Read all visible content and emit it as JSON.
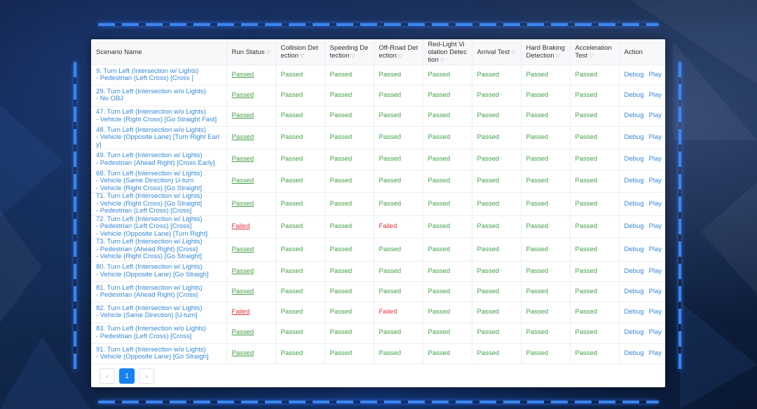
{
  "columns": [
    {
      "label": "Scenario Name",
      "filter": false
    },
    {
      "label": "Run Status",
      "filter": true
    },
    {
      "label": "Collision Det ection",
      "filter": true
    },
    {
      "label": "Speeding De tection",
      "filter": true
    },
    {
      "label": "Off-Road Det ection",
      "filter": true
    },
    {
      "label": "Red-Light Vi olation Detec tion",
      "filter": true
    },
    {
      "label": "Arrival Test",
      "filter": true
    },
    {
      "label": "Hard Braking Detection",
      "filter": true
    },
    {
      "label": "Acceleration Test",
      "filter": true
    },
    {
      "label": "Action",
      "filter": false
    }
  ],
  "filter_icon": "funnel-icon",
  "rows": [
    {
      "scenario": "9. Turn Left (Intersection w/ Lights)\n - Pedestrian (Left Cross) [Cross ]",
      "run": "Passed",
      "collision": "Passed",
      "speeding": "Passed",
      "offroad": "Passed",
      "redlight": "Passed",
      "arrival": "Passed",
      "braking": "Passed",
      "accel": "Passed"
    },
    {
      "scenario": "29. Turn Left (Intersection w/o Lights)\n - No OBJ",
      "run": "Passed",
      "collision": "Passed",
      "speeding": "Passed",
      "offroad": "Passed",
      "redlight": "Passed",
      "arrival": "Passed",
      "braking": "Passed",
      "accel": "Passed"
    },
    {
      "scenario": "47. Turn Left (Intersection w/o Lights)\n - Vehicle (Right Cross) [Go Straight Fast]",
      "run": "Passed",
      "collision": "Passed",
      "speeding": "Passed",
      "offroad": "Passed",
      "redlight": "Passed",
      "arrival": "Passed",
      "braking": "Passed",
      "accel": "Passed"
    },
    {
      "scenario": "48. Turn Left (Intersection w/o Lights)\n - Vehicle (Opposite Lane) [Turn Right Earl\ny]",
      "run": "Passed",
      "collision": "Passed",
      "speeding": "Passed",
      "offroad": "Passed",
      "redlight": "Passed",
      "arrival": "Passed",
      "braking": "Passed",
      "accel": "Passed"
    },
    {
      "scenario": "49. Turn Left (Intersection w/ Lights)\n - Pedestrian (Ahead Right) [Cross Early]",
      "run": "Passed",
      "collision": "Passed",
      "speeding": "Passed",
      "offroad": "Passed",
      "redlight": "Passed",
      "arrival": "Passed",
      "braking": "Passed",
      "accel": "Passed"
    },
    {
      "scenario": "68. Turn Left (Intersection w/ Lights)\n - Vehicle (Same Direction) U-turn\n - Vehicle (Right Cross) [Go Straight]",
      "run": "Passed",
      "collision": "Passed",
      "speeding": "Passed",
      "offroad": "Passed",
      "redlight": "Passed",
      "arrival": "Passed",
      "braking": "Passed",
      "accel": "Passed"
    },
    {
      "scenario": "71. Turn Left (Intersection w/ Lights)\n - Vehicle (Right Cross) [Go Straight]\n - Pedestrian (Left Cross) [Cross]",
      "run": "Passed",
      "collision": "Passed",
      "speeding": "Passed",
      "offroad": "Passed",
      "redlight": "Passed",
      "arrival": "Passed",
      "braking": "Passed",
      "accel": "Passed"
    },
    {
      "scenario": "72. Turn Left (Intersection w/ Lights)\n - Pedestrian (Left Cross) [Cross]\n - Vehicle (Opposite Lane) [Turn Right]",
      "run": "Failed",
      "collision": "Passed",
      "speeding": "Passed",
      "offroad": "Failed",
      "redlight": "Passed",
      "arrival": "Passed",
      "braking": "Passed",
      "accel": "Passed"
    },
    {
      "scenario": "73. Turn Left (Intersection w/ Lights)\n - Pedestrian (Ahead Right) [Cross]\n - Vehicle (Right Cross) [Go Straight]",
      "run": "Passed",
      "collision": "Passed",
      "speeding": "Passed",
      "offroad": "Passed",
      "redlight": "Passed",
      "arrival": "Passed",
      "braking": "Passed",
      "accel": "Passed"
    },
    {
      "scenario": "80. Turn Left (Intersection w/ Lights)\n - Vehicle (Opposite Lane) [Go Straigh]",
      "run": "Passed",
      "collision": "Passed",
      "speeding": "Passed",
      "offroad": "Passed",
      "redlight": "Passed",
      "arrival": "Passed",
      "braking": "Passed",
      "accel": "Passed"
    },
    {
      "scenario": "81. Turn Left (Intersection w/ Lights)\n - Pedestrian (Ahead Right) [Cross]",
      "run": "Passed",
      "collision": "Passed",
      "speeding": "Passed",
      "offroad": "Passed",
      "redlight": "Passed",
      "arrival": "Passed",
      "braking": "Passed",
      "accel": "Passed"
    },
    {
      "scenario": "82. Turn Left (Intersection w/ Lights)\n - Vehicle (Same Direction) [U-turn]",
      "run": "Failed",
      "collision": "Passed",
      "speeding": "Passed",
      "offroad": "Failed",
      "redlight": "Passed",
      "arrival": "Passed",
      "braking": "Passed",
      "accel": "Passed"
    },
    {
      "scenario": "83. Turn Left (Intersection w/o Lights)\n - Pedestrian (Left Cross) [Cross]",
      "run": "Passed",
      "collision": "Passed",
      "speeding": "Passed",
      "offroad": "Passed",
      "redlight": "Passed",
      "arrival": "Passed",
      "braking": "Passed",
      "accel": "Passed"
    },
    {
      "scenario": "91. Turn Left (Intersection w/o Lights)\n - Vehicle (Opposite Lane) [Go Straigh]",
      "run": "Passed",
      "collision": "Passed",
      "speeding": "Passed",
      "offroad": "Passed",
      "redlight": "Passed",
      "arrival": "Passed",
      "braking": "Passed",
      "accel": "Passed"
    }
  ],
  "actions": {
    "debug": "Debug",
    "play": "Play"
  },
  "pagination": {
    "prev": "‹",
    "current": "1",
    "next": "›"
  },
  "colors": {
    "passed": "#43a047",
    "failed": "#e0333a",
    "link": "#3488d6",
    "accent": "#1782f0"
  }
}
